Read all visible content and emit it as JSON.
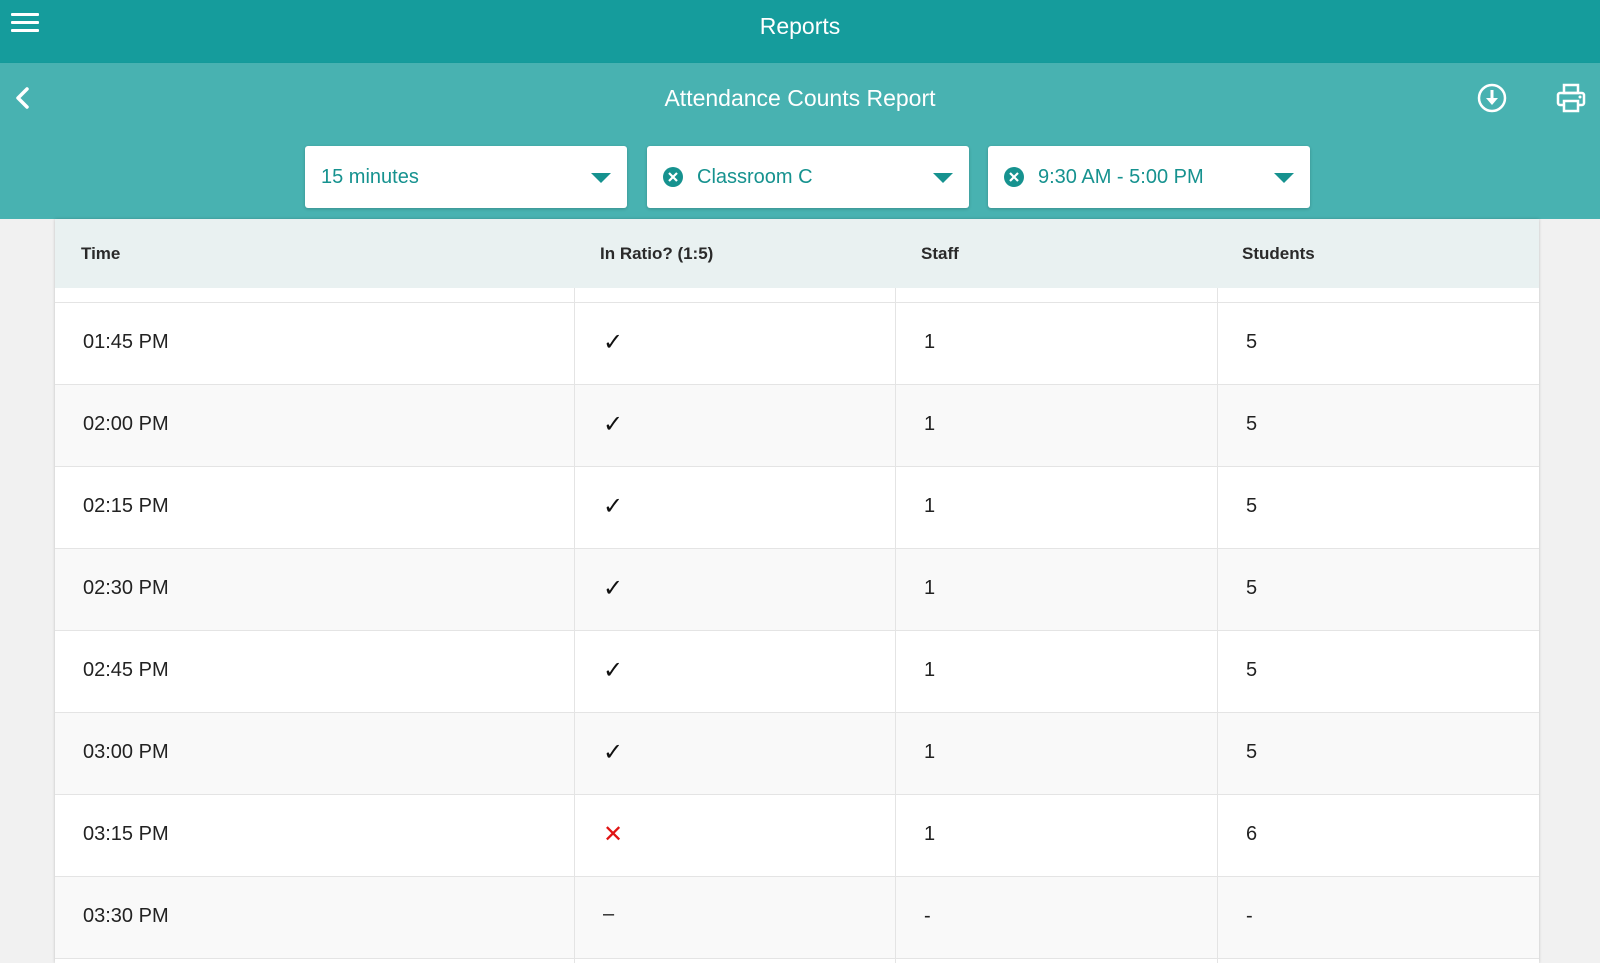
{
  "header": {
    "title": "Reports"
  },
  "subheader": {
    "title": "Attendance Counts Report"
  },
  "filters": {
    "interval": "15 minutes",
    "classroom": "Classroom C",
    "time_range": "9:30 AM - 5:00 PM"
  },
  "colors": {
    "topbar": "#159c9c",
    "subbar": "#48b2b1",
    "accent_text": "#16928f",
    "out_of_ratio": "#e01414"
  },
  "table": {
    "columns": {
      "time": "Time",
      "in_ratio": "In Ratio? (1:5)",
      "staff": "Staff",
      "students": "Students"
    },
    "rows": [
      {
        "time": "01:45 PM",
        "in_ratio": "✓",
        "status": "ok",
        "staff": "1",
        "students": "5"
      },
      {
        "time": "02:00 PM",
        "in_ratio": "✓",
        "status": "ok",
        "staff": "1",
        "students": "5"
      },
      {
        "time": "02:15 PM",
        "in_ratio": "✓",
        "status": "ok",
        "staff": "1",
        "students": "5"
      },
      {
        "time": "02:30 PM",
        "in_ratio": "✓",
        "status": "ok",
        "staff": "1",
        "students": "5"
      },
      {
        "time": "02:45 PM",
        "in_ratio": "✓",
        "status": "ok",
        "staff": "1",
        "students": "5"
      },
      {
        "time": "03:00 PM",
        "in_ratio": "✓",
        "status": "ok",
        "staff": "1",
        "students": "5"
      },
      {
        "time": "03:15 PM",
        "in_ratio": "✕",
        "status": "bad",
        "staff": "1",
        "students": "6"
      },
      {
        "time": "03:30 PM",
        "in_ratio": "–",
        "status": "none",
        "staff": "-",
        "students": "-"
      }
    ]
  }
}
